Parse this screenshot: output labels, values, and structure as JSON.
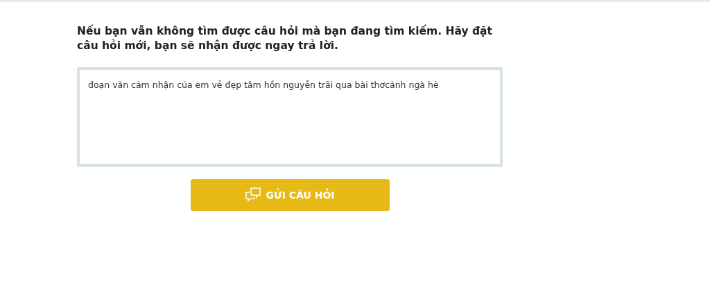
{
  "prompt": "Nếu bạn vẫn không tìm được câu hỏi mà bạn đang tìm kiếm. Hãy đặt câu hỏi mới, bạn sẽ nhận được ngay trả lời.",
  "question": {
    "value": "đoạn văn cảm nhận của em vẻ đẹp tâm hồn nguyễn trãi qua bài thơcảnh ngà hè"
  },
  "submit_button": {
    "label": "GỬI CÂU HỎI"
  }
}
